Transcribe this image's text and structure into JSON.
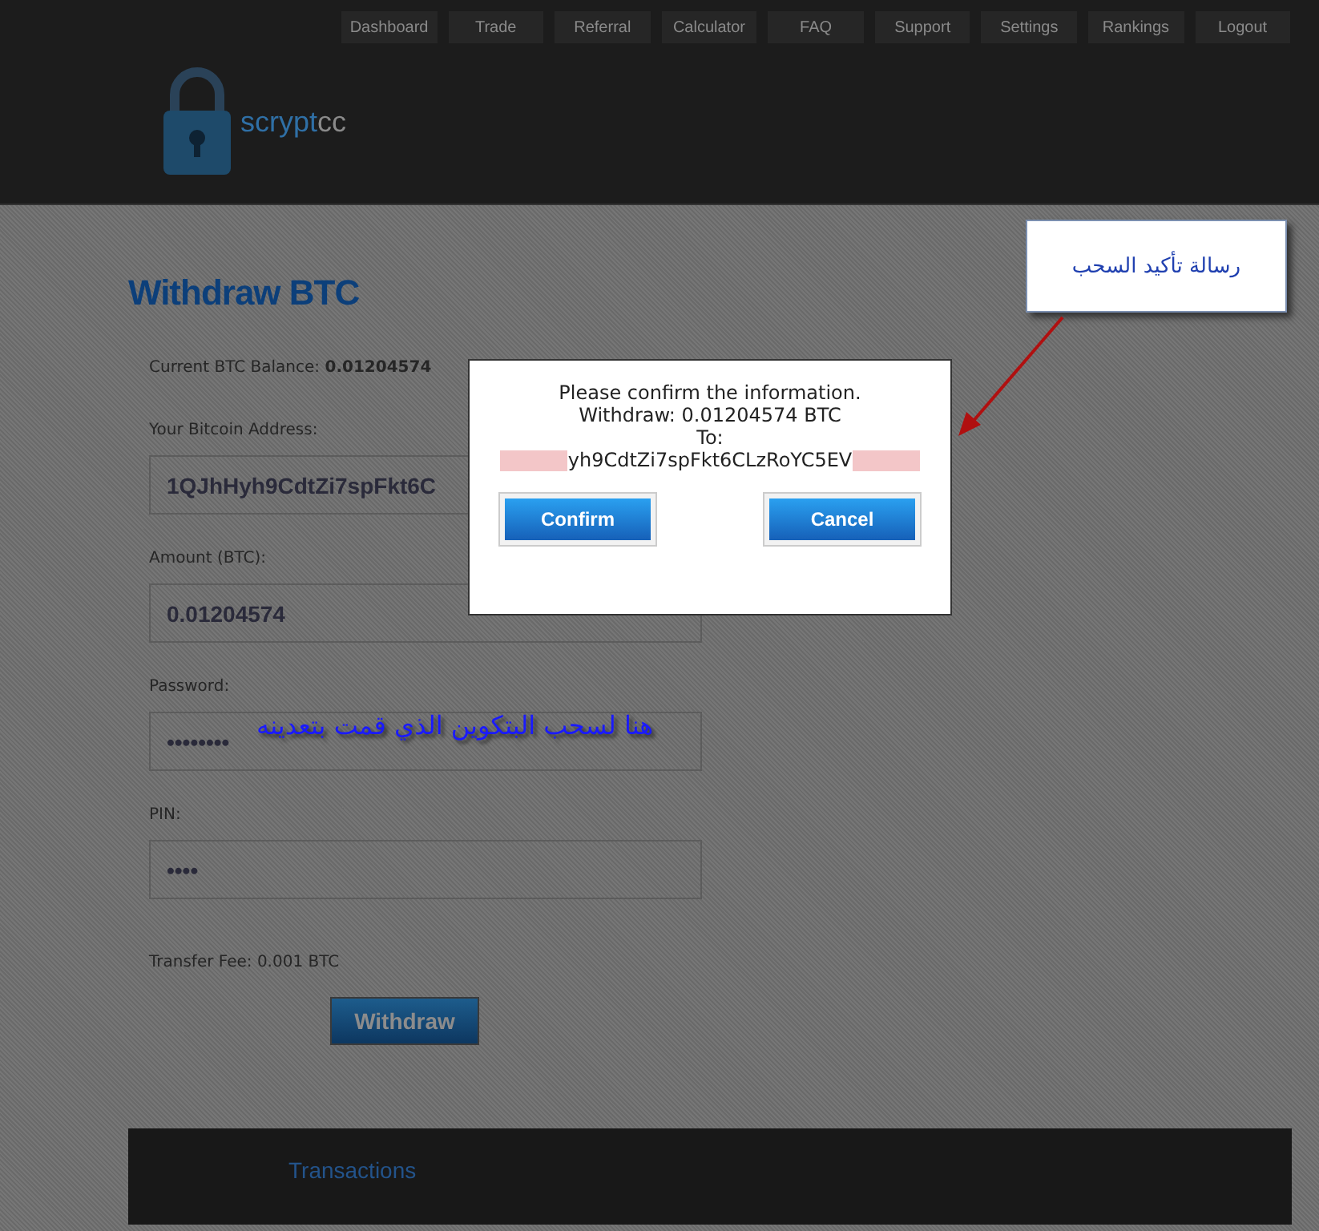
{
  "nav": [
    {
      "label": "Dashboard"
    },
    {
      "label": "Trade"
    },
    {
      "label": "Referral"
    },
    {
      "label": "Calculator"
    },
    {
      "label": "FAQ"
    },
    {
      "label": "Support"
    },
    {
      "label": "Settings"
    },
    {
      "label": "Rankings"
    },
    {
      "label": "Logout"
    }
  ],
  "logo": {
    "first": "scrypt",
    "second": "cc"
  },
  "page_title": "Withdraw BTC",
  "balance": {
    "label": "Current BTC Balance:",
    "value": "0.01204574"
  },
  "fields": [
    {
      "label": "Your Bitcoin Address:",
      "value": "1QJhHyh9CdtZi7spFkt6C"
    },
    {
      "label": "Amount (BTC):",
      "value": "0.01204574"
    },
    {
      "label": "Password:",
      "value": "••••••••"
    },
    {
      "label": "PIN:",
      "value": "••••"
    }
  ],
  "fee": "Transfer Fee: 0.001 BTC",
  "withdraw_button": "Withdraw",
  "transactions_title": "Transactions",
  "dialog": {
    "lines": [
      "Please confirm the information.",
      "Withdraw: 0.01204574 BTC",
      "To:"
    ],
    "address": "yh9CdtZi7spFkt6CLzRoYC5EV",
    "buttons": [
      "Confirm",
      "Cancel"
    ]
  },
  "annotations": {
    "callout": "رسالة تأكيد السحب",
    "note": "هنا لسحب البتكوين الذي قمت بتعدينه"
  }
}
